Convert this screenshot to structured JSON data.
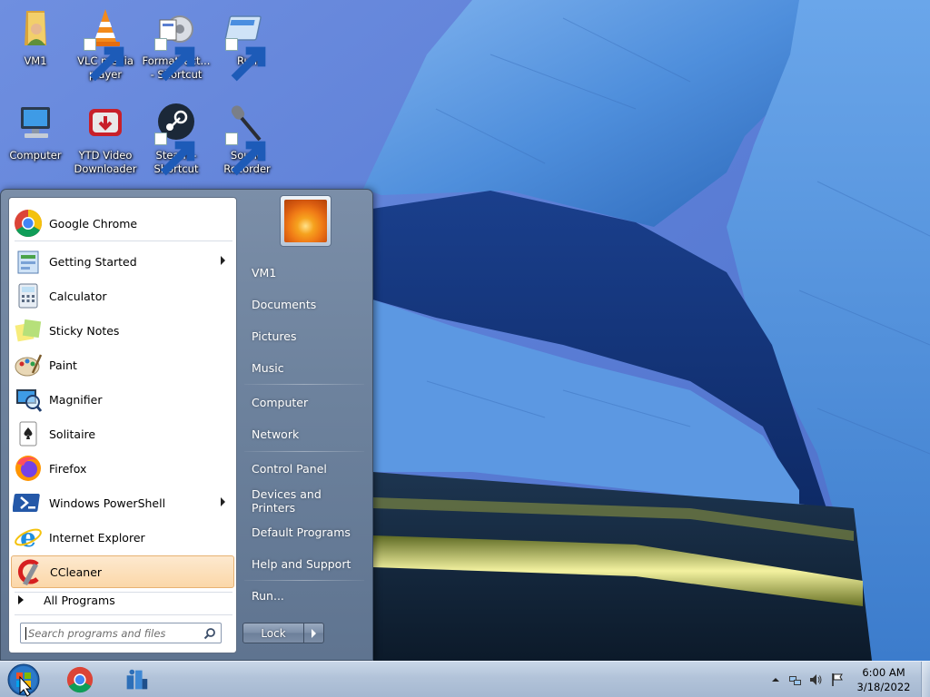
{
  "desktop": {
    "icons": [
      {
        "label": "VM1",
        "icon": "user-folder-icon"
      },
      {
        "label": "VLC media player",
        "icon": "vlc-cone-icon"
      },
      {
        "label": "FormatFact... - Shortcut",
        "icon": "format-factory-icon"
      },
      {
        "label": "Run",
        "icon": "run-icon"
      },
      {
        "label": "Computer",
        "icon": "computer-icon"
      },
      {
        "label": "YTD Video Downloader",
        "icon": "ytd-downloader-icon"
      },
      {
        "label": "Steam - Shortcut",
        "icon": "steam-icon"
      },
      {
        "label": "Sound Recorder",
        "icon": "microphone-icon"
      }
    ]
  },
  "start_menu": {
    "programs": [
      {
        "label": "Google Chrome",
        "icon": "chrome-icon",
        "has_submenu": false
      },
      {
        "label": "Getting Started",
        "icon": "getting-started-icon",
        "has_submenu": true
      },
      {
        "label": "Calculator",
        "icon": "calculator-icon",
        "has_submenu": false
      },
      {
        "label": "Sticky Notes",
        "icon": "sticky-notes-icon",
        "has_submenu": false
      },
      {
        "label": "Paint",
        "icon": "paint-icon",
        "has_submenu": false
      },
      {
        "label": "Magnifier",
        "icon": "magnifier-icon",
        "has_submenu": false
      },
      {
        "label": "Solitaire",
        "icon": "solitaire-icon",
        "has_submenu": false
      },
      {
        "label": "Firefox",
        "icon": "firefox-icon",
        "has_submenu": false
      },
      {
        "label": "Windows PowerShell",
        "icon": "powershell-icon",
        "has_submenu": true
      },
      {
        "label": "Internet Explorer",
        "icon": "internet-explorer-icon",
        "has_submenu": false
      },
      {
        "label": "CCleaner",
        "icon": "ccleaner-icon",
        "has_submenu": false,
        "highlighted": true
      }
    ],
    "all_programs_label": "All Programs",
    "search_placeholder": "Search programs and files",
    "right_items": [
      "VM1",
      "Documents",
      "Pictures",
      "Music",
      "Computer",
      "Network",
      "Control Panel",
      "Devices and Printers",
      "Default Programs",
      "Help and Support",
      "Run..."
    ],
    "lock_label": "Lock"
  },
  "taskbar": {
    "pinned": [
      {
        "name": "Google Chrome",
        "icon": "chrome-icon"
      },
      {
        "name": "Network app",
        "icon": "network-app-icon"
      }
    ],
    "tray_icons": [
      "show-hidden-icons-arrow",
      "network-icon",
      "volume-icon",
      "action-center-flag-icon"
    ],
    "clock": {
      "time": "6:00 AM",
      "date": "3/18/2022"
    }
  },
  "colors": {
    "sky": "#5a7fd0",
    "building_blue": "#3f7fd0",
    "menu_panel": "#6e839e",
    "highlight": "#fbd7a8"
  }
}
